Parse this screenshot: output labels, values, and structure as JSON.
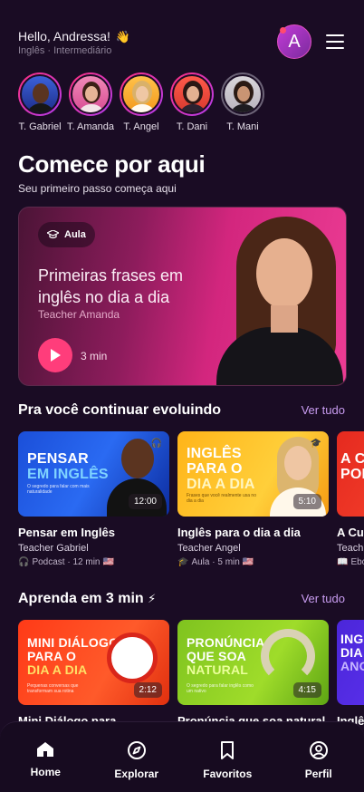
{
  "header": {
    "greeting": "Hello, Andressa!",
    "wave_emoji": "👋",
    "level": "Inglês · Intermediário",
    "avatar_letter": "A"
  },
  "teachers": [
    {
      "name": "T. Gabriel"
    },
    {
      "name": "T. Amanda"
    },
    {
      "name": "T. Angel"
    },
    {
      "name": "T. Dani"
    },
    {
      "name": "T. Mani"
    }
  ],
  "start": {
    "title": "Comece por aqui",
    "subtitle": "Seu primeiro passo começa aqui"
  },
  "hero": {
    "badge": "Aula",
    "title": "Primeiras frases em inglês no dia a dia",
    "teacher": "Teacher Amanda",
    "duration": "3 min"
  },
  "continue_section": {
    "title": "Pra você continuar evoluindo",
    "see_all": "Ver tudo",
    "cards": [
      {
        "thumb_line1": "PENSAR",
        "thumb_line2": "EM INGLÊS",
        "thumb_small": "O segredo para falar com mais naturalidade",
        "duration": "12:00",
        "title": "Pensar em Inglês",
        "teacher": "Teacher Gabriel",
        "meta": "Podcast · 12 min",
        "flag": "🇺🇸"
      },
      {
        "thumb_line1": "INGLÊS",
        "thumb_line2": "PARA O",
        "thumb_line3": "DIA A DIA",
        "thumb_small": "Frases que você realmente usa no dia a dia",
        "duration": "5:10",
        "title": "Inglês para o dia a dia",
        "teacher": "Teacher Angel",
        "meta": "Aula · 5 min",
        "flag": "🇺🇸"
      },
      {
        "thumb_line1": "A CU",
        "thumb_line2": "POP",
        "title": "A Cul",
        "teacher": "Teach",
        "meta": "Ebo"
      }
    ]
  },
  "quick_section": {
    "title": "Aprenda em 3 min",
    "bolt": "⚡",
    "see_all": "Ver tudo",
    "cards": [
      {
        "thumb_line1": "MINI DIÁLOGO",
        "thumb_line2": "PARA O",
        "thumb_line3": "DIA A DIA",
        "thumb_small": "Pequenas conversas que transformam sua rotina",
        "duration": "2:12",
        "title": "Mini Diálogo para"
      },
      {
        "thumb_line1": "PRONÚNCIA",
        "thumb_line2": "QUE SOA",
        "thumb_line3": "NATURAL",
        "thumb_small": "O segredo para falar inglês como um nativo",
        "duration": "4:15",
        "title": "Pronúncia que soa natural"
      },
      {
        "thumb_line1": "ING",
        "thumb_line2": "DIA",
        "thumb_line3": "ANO",
        "title": "Inglê"
      }
    ]
  },
  "nav": {
    "home": "Home",
    "explore": "Explorar",
    "favorites": "Favoritos",
    "profile": "Perfil"
  },
  "colors": {
    "background": "#1a0c24",
    "accent_pink": "#ff3d7b",
    "link_purple": "#c89cf0"
  }
}
